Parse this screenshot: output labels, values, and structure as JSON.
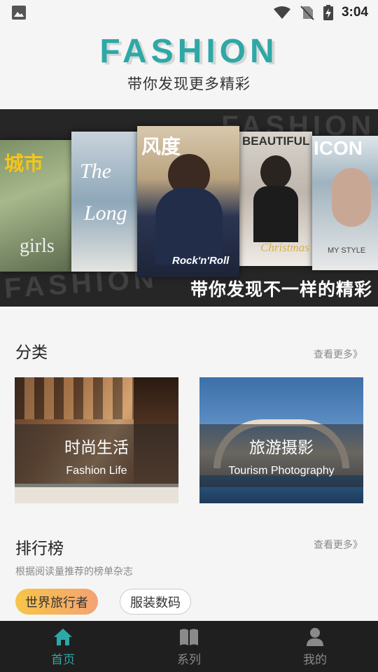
{
  "status_bar": {
    "time": "3:04"
  },
  "header": {
    "logo_text": "FASHION",
    "slogan": "带你发现更多精彩"
  },
  "banner": {
    "caption": "带你发现不一样的精彩",
    "watermark_top": "FASHION",
    "watermark_bottom": "FASHION",
    "covers": [
      {
        "title": "城市",
        "subtitle": "girls"
      },
      {
        "title": "The",
        "subtitle": "Long"
      },
      {
        "title": "风度",
        "subtitle": "Rock'n'Roll"
      },
      {
        "title": "BEAUTIFUL",
        "subtitle": "Christmas"
      },
      {
        "title": "ICON",
        "subtitle": "MY STYLE"
      }
    ]
  },
  "categories": {
    "title": "分类",
    "more": "查看更多》",
    "items": [
      {
        "cn": "时尚生活",
        "en": "Fashion Life"
      },
      {
        "cn": "旅游摄影",
        "en": "Tourism Photography"
      }
    ]
  },
  "ranking": {
    "title": "排行榜",
    "more": "查看更多》",
    "subtitle": "根据阅读量推荐的榜单杂志",
    "chips": [
      {
        "label": "世界旅行者"
      },
      {
        "label": "服装数码"
      }
    ]
  },
  "nav": {
    "items": [
      {
        "label": "首页",
        "icon": "home-icon"
      },
      {
        "label": "系列",
        "icon": "book-icon"
      },
      {
        "label": "我的",
        "icon": "user-icon"
      }
    ],
    "active_color": "#2ea8a6"
  },
  "colors": {
    "accent": "#2ea8a6",
    "chip_gradient": [
      "#f7c548",
      "#f3a373"
    ]
  }
}
